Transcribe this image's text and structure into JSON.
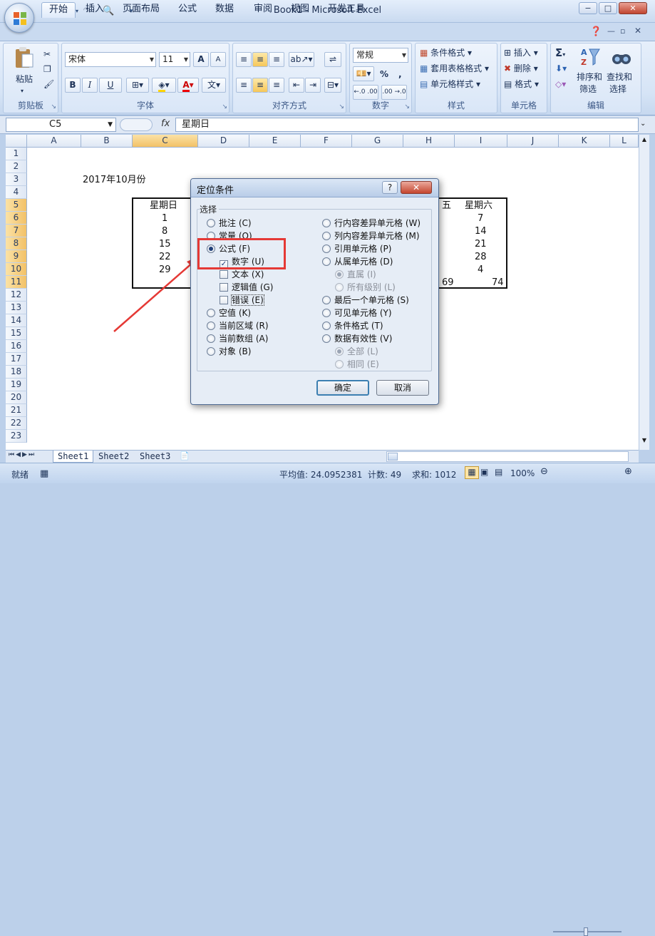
{
  "window": {
    "title": "Book1 - Microsoft Excel",
    "controls": [
      "−",
      "□",
      "✕"
    ]
  },
  "qat": {
    "icons": [
      "save-icon",
      "undo-icon",
      "redo-icon",
      "print-preview-icon",
      "customize-icon"
    ]
  },
  "ribbon": {
    "tabs": [
      "开始",
      "插入",
      "页面布局",
      "公式",
      "数据",
      "审阅",
      "视图",
      "开发工具"
    ],
    "active_tab": "开始",
    "groups": {
      "clipboard": {
        "label": "剪贴板",
        "paste": "粘贴"
      },
      "font": {
        "label": "字体",
        "font_name": "宋体",
        "font_size": "11",
        "bold": "B",
        "italic": "I",
        "underline": "U",
        "grow": "A",
        "shrink": "A",
        "phonetic": "文",
        "font_color_glyph": "A"
      },
      "alignment": {
        "label": "对齐方式"
      },
      "number": {
        "label": "数字",
        "format": "常规",
        "percent": "%",
        "comma": ",",
        "inc_decimal": "←.0 .00",
        "dec_decimal": ".00 →.0"
      },
      "styles": {
        "label": "样式",
        "conditional": "条件格式",
        "table": "套用表格格式",
        "cell": "单元格样式"
      },
      "cells": {
        "label": "单元格",
        "insert": "插入",
        "delete": "删除",
        "format": "格式"
      },
      "editing": {
        "label": "编辑",
        "sort": "排序和\n筛选",
        "sort_line1": "排序和",
        "sort_line2": "筛选",
        "find_line1": "查找和",
        "find_line2": "选择",
        "sum": "Σ"
      }
    }
  },
  "formula_bar": {
    "name_box": "C5",
    "fx": "fx",
    "value": "星期日"
  },
  "grid": {
    "columns": [
      "A",
      "B",
      "C",
      "D",
      "E",
      "F",
      "G",
      "H",
      "I",
      "J",
      "K",
      "L"
    ],
    "rows": [
      "1",
      "2",
      "3",
      "4",
      "5",
      "6",
      "7",
      "8",
      "9",
      "10",
      "11",
      "12",
      "13",
      "14",
      "15",
      "16",
      "17",
      "18",
      "19",
      "20",
      "21",
      "22",
      "23"
    ],
    "title_cell": "2017年10月份",
    "header_left": "星期日",
    "header_right": "星期六",
    "header_h_partial": "五",
    "col_c": [
      "1",
      "8",
      "15",
      "22",
      "29"
    ],
    "col_i": [
      "7",
      "14",
      "21",
      "28",
      "4"
    ],
    "row11_h": "69",
    "row11_i": "74"
  },
  "sheets": {
    "tabs": [
      "Sheet1",
      "Sheet2",
      "Sheet3"
    ],
    "active": "Sheet1"
  },
  "status": {
    "ready": "就绪",
    "average": "平均值: 24.0952381",
    "count": "计数: 49",
    "sum": "求和: 1012",
    "zoom": "100%"
  },
  "dialog": {
    "title": "定位条件",
    "help": "?",
    "close": "✕",
    "section": "选择",
    "left_options": [
      {
        "label": "批注 (C)",
        "type": "radio",
        "checked": false
      },
      {
        "label": "常量 (O)",
        "type": "radio",
        "checked": false
      },
      {
        "label": "公式 (F)",
        "type": "radio",
        "checked": true
      },
      {
        "label": "数字 (U)",
        "type": "check",
        "checked": true
      },
      {
        "label": "文本 (X)",
        "type": "check",
        "checked": false
      },
      {
        "label": "逻辑值 (G)",
        "type": "check",
        "checked": false
      },
      {
        "label": "错误 (E)",
        "type": "check",
        "checked": false
      },
      {
        "label": "空值 (K)",
        "type": "radio",
        "checked": false
      },
      {
        "label": "当前区域 (R)",
        "type": "radio",
        "checked": false
      },
      {
        "label": "当前数组 (A)",
        "type": "radio",
        "checked": false
      },
      {
        "label": "对象 (B)",
        "type": "radio",
        "checked": false
      }
    ],
    "right_options": [
      {
        "label": "行内容差异单元格 (W)",
        "type": "radio",
        "checked": false
      },
      {
        "label": "列内容差异单元格 (M)",
        "type": "radio",
        "checked": false
      },
      {
        "label": "引用单元格 (P)",
        "type": "radio",
        "checked": false
      },
      {
        "label": "从属单元格 (D)",
        "type": "radio",
        "checked": false
      },
      {
        "label": "直属 (I)",
        "type": "radio",
        "checked": true,
        "disabled": true
      },
      {
        "label": "所有级别 (L)",
        "type": "radio",
        "checked": false,
        "disabled": true
      },
      {
        "label": "最后一个单元格 (S)",
        "type": "radio",
        "checked": false
      },
      {
        "label": "可见单元格 (Y)",
        "type": "radio",
        "checked": false
      },
      {
        "label": "条件格式 (T)",
        "type": "radio",
        "checked": false
      },
      {
        "label": "数据有效性 (V)",
        "type": "radio",
        "checked": false
      },
      {
        "label": "全部 (L)",
        "type": "radio",
        "checked": true,
        "disabled": true
      },
      {
        "label": "相同 (E)",
        "type": "radio",
        "checked": false,
        "disabled": true
      }
    ],
    "ok": "确定",
    "cancel": "取消"
  },
  "colors": {
    "accent_highlight": "#e53935",
    "selected_header": "#f2c167"
  }
}
